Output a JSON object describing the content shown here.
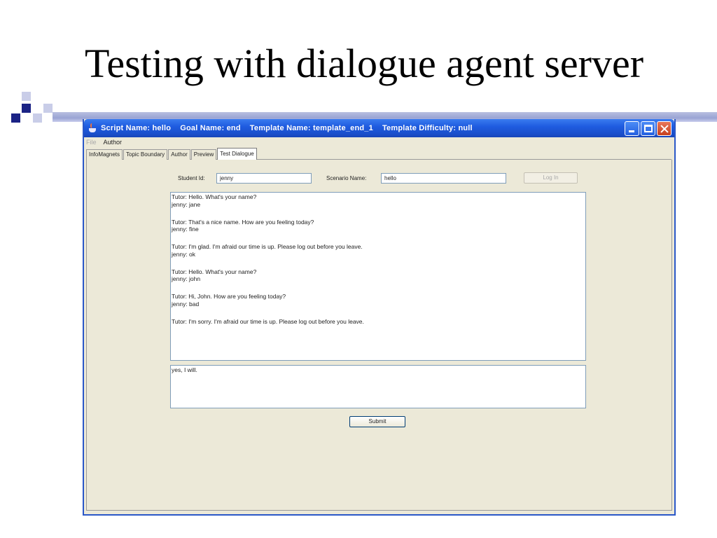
{
  "slide": {
    "title": "Testing with dialogue agent server"
  },
  "window": {
    "title": "Script Name: hello    Goal Name: end    Template Name: template_end_1    Template Difficulty: null"
  },
  "menu": {
    "file": "File",
    "author": "Author"
  },
  "tabs": [
    {
      "label": "InfoMagnets"
    },
    {
      "label": "Topic Boundary"
    },
    {
      "label": "Author"
    },
    {
      "label": "Preview"
    },
    {
      "label": "Test Dialogue",
      "active": true
    }
  ],
  "form": {
    "student_id_label": "Student Id:",
    "student_id_value": "jenny",
    "scenario_label": "Scenario Name:",
    "scenario_value": "hello",
    "login_label": "Log In"
  },
  "transcript": [
    [
      "Tutor: Hello. What's your name?",
      "jenny: jane"
    ],
    [
      "Tutor: That's a nice name. How are you feeling today?",
      "jenny: fine"
    ],
    [
      "Tutor: I'm glad. I'm afraid our time is up. Please log out before you leave.",
      "jenny: ok"
    ],
    [
      "Tutor: Hello. What's your name?",
      "jenny: john"
    ],
    [
      "Tutor: Hi, John. How are you feeling today?",
      "jenny: bad"
    ],
    [
      "Tutor: I'm sorry. I'm afraid our time is up. Please log out before you leave."
    ]
  ],
  "reply": {
    "value": "yes, I will."
  },
  "submit": {
    "label": "Submit"
  },
  "colors": {
    "titlebar": "#1f5ce0",
    "window_bg": "#ece9d8",
    "deco_dark": "#1b2385"
  }
}
